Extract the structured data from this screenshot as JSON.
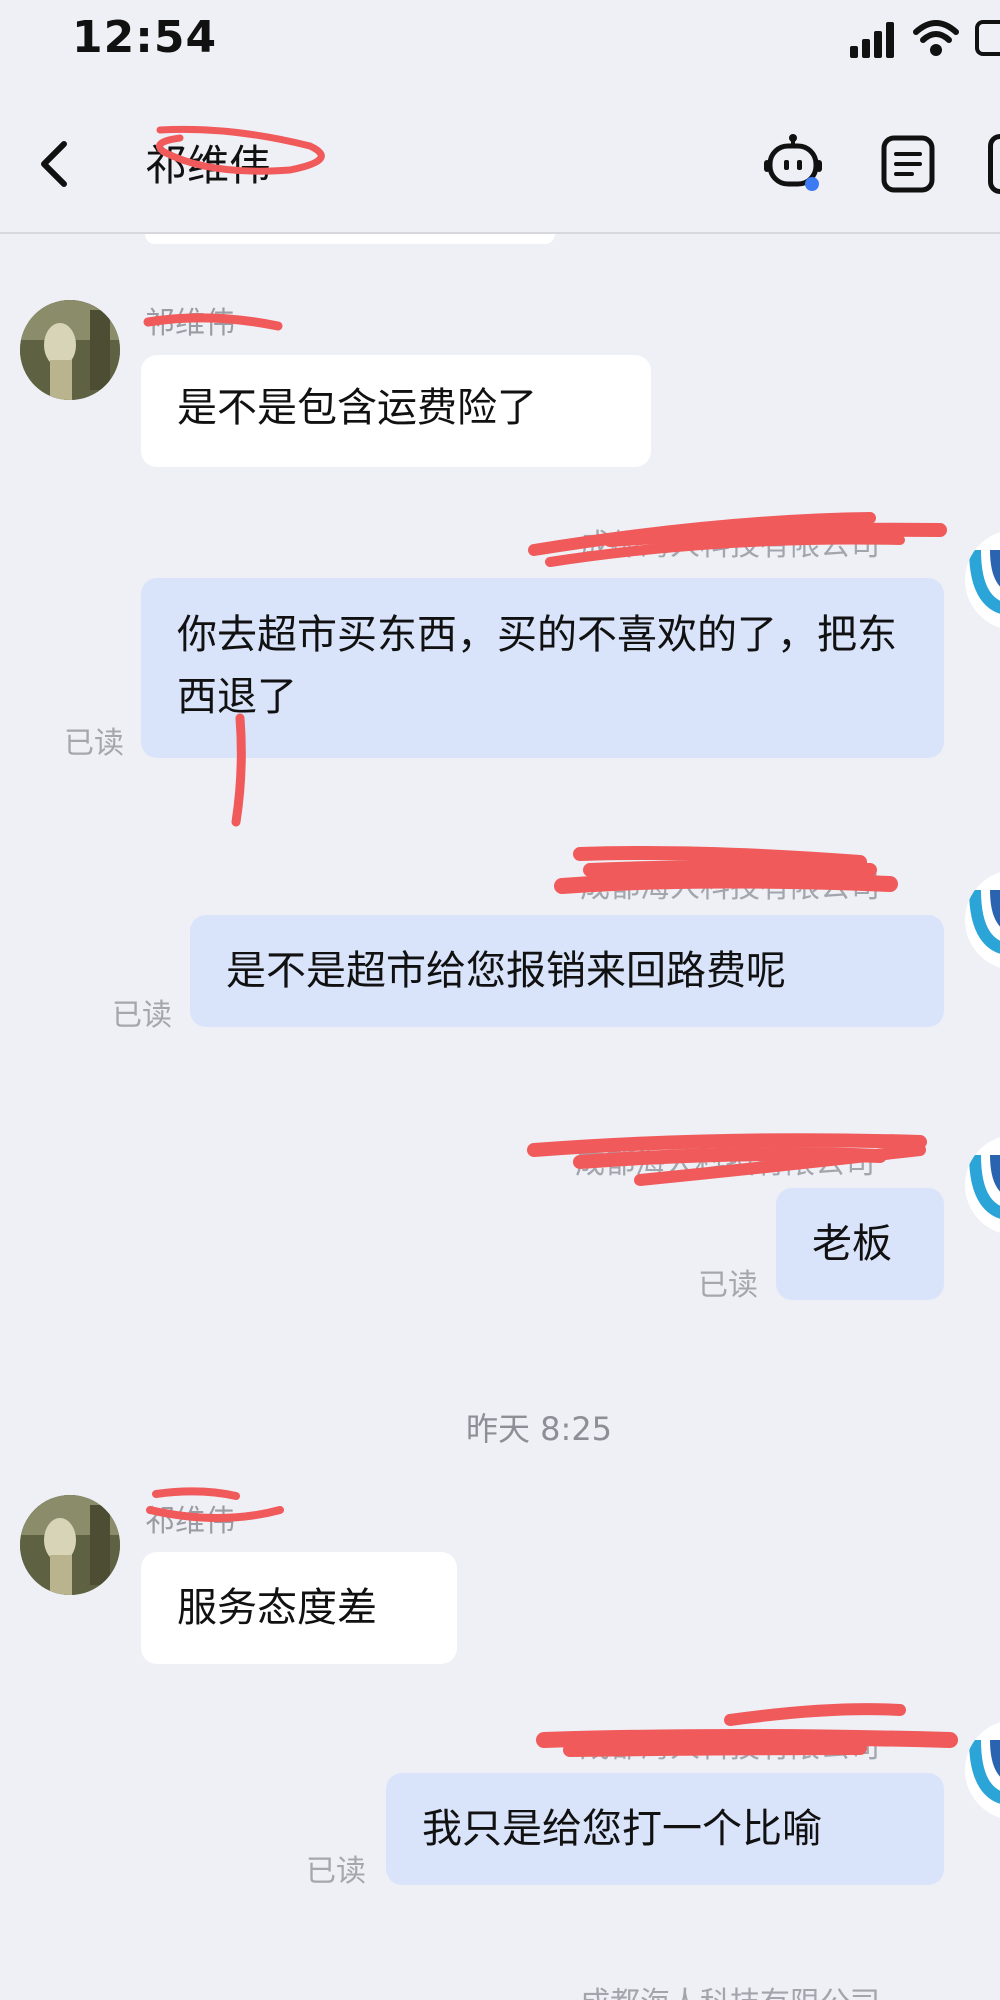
{
  "status_bar": {
    "time": "12:54"
  },
  "header": {
    "title": "祁维伟"
  },
  "messages": [
    {
      "sender": "祁维伟",
      "text": "是不是包含运费险了"
    },
    {
      "sender": "成都海人科技有限公司",
      "text": "你去超市买东西，买的不喜欢的了，把东西退了",
      "read": "已读"
    },
    {
      "sender": "成都海人科技有限公司",
      "text": "是不是超市给您报销来回路费呢",
      "read": "已读"
    },
    {
      "sender": "成都海人科技有限公司",
      "text": "老板",
      "read": "已读"
    },
    {
      "sender": "祁维伟",
      "text": "服务态度差"
    },
    {
      "sender": "成都海人科技有限公司",
      "text": "我只是给您打一个比喻",
      "read": "已读"
    }
  ],
  "timestamp": "昨天 8:25",
  "footer_sender": "成都海人科技有限公司",
  "colors": {
    "background": "#eef0f6",
    "incoming_bubble": "#ffffff",
    "outgoing_bubble": "#d9e4fb",
    "redaction": "#f05a5a"
  },
  "icons": [
    "back-arrow-icon",
    "robot-icon",
    "notes-icon",
    "more-icon",
    "signal-icon",
    "wifi-icon"
  ]
}
